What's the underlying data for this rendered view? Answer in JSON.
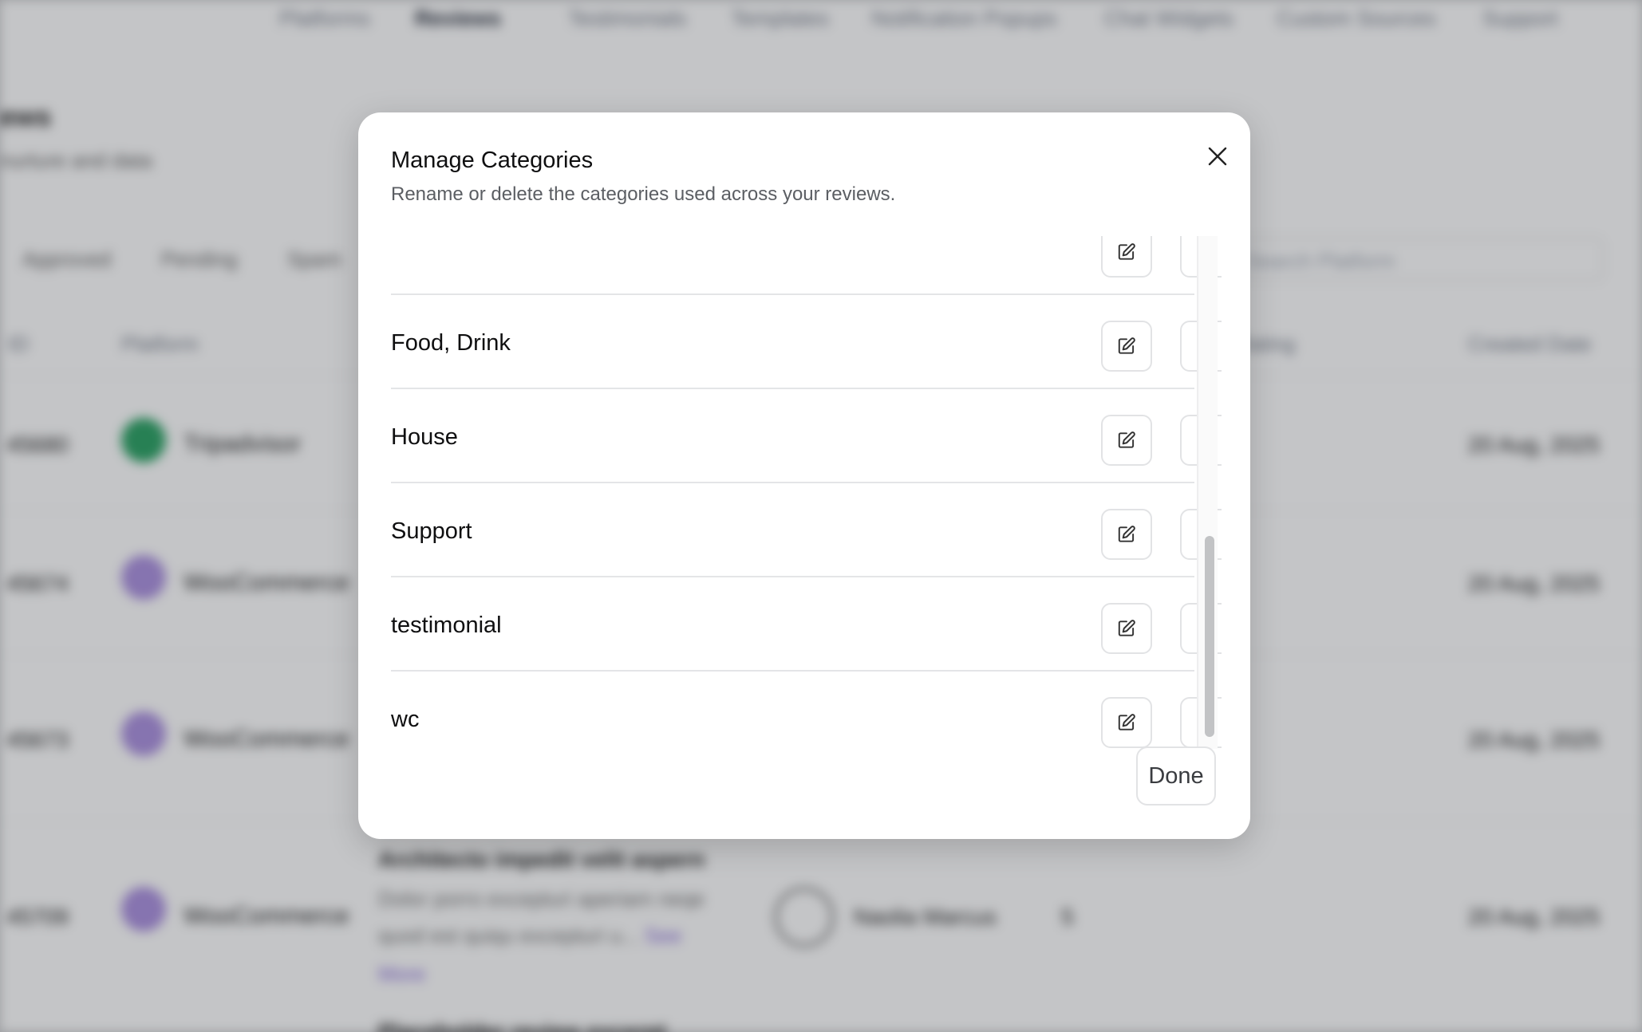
{
  "background": {
    "nav": [
      "Platforms",
      "Reviews",
      "Testimonials",
      "Templates",
      "Notification Popups",
      "Chat Widgets",
      "Custom Sources",
      "Support"
    ],
    "header_title": "ews",
    "header_subtitle": "nurture and data",
    "tabs": [
      "Approved",
      "Pending",
      "Spam"
    ],
    "search_placeholder": "Search Platform",
    "columns": {
      "id": "ID",
      "platform": "Platform",
      "rating": "Rating",
      "created": "Created Date"
    },
    "rows": [
      {
        "id": "45680",
        "platform": "Tripadvisor",
        "date": "20 Aug, 2025"
      },
      {
        "id": "45674",
        "platform": "WooCommerce",
        "date": "20 Aug, 2025"
      },
      {
        "id": "45673",
        "platform": "WooCommerce",
        "date": "20 Aug, 2025"
      },
      {
        "id": "45709",
        "platform": "WooCommerce",
        "date": "20 Aug, 2025"
      }
    ],
    "review_title": "Architecto impedit velit aspern",
    "review_lines": [
      "Dolor porro excepturi aperiam neqe",
      "quod est quiqu excepturi u..."
    ],
    "review_more_a": "See",
    "review_more_b": "More",
    "author": "Naolia Marcus",
    "rating": "5",
    "next_title": "Placeholder review excerpt"
  },
  "modal": {
    "title": "Manage Categories",
    "description": "Rename or delete the categories used across your reviews.",
    "categories": [
      {
        "name": ""
      },
      {
        "name": "Food, Drink"
      },
      {
        "name": "House"
      },
      {
        "name": "Support"
      },
      {
        "name": "testimonial"
      },
      {
        "name": "wc"
      }
    ],
    "done_label": "Done"
  },
  "icons": {
    "close": "close-icon",
    "edit": "edit-icon",
    "delete": "trash-icon"
  },
  "colors": {
    "overlay": "#c4c5c7",
    "text": "#0f0f10",
    "muted": "#5b5e63",
    "border": "#e2e3e5"
  }
}
